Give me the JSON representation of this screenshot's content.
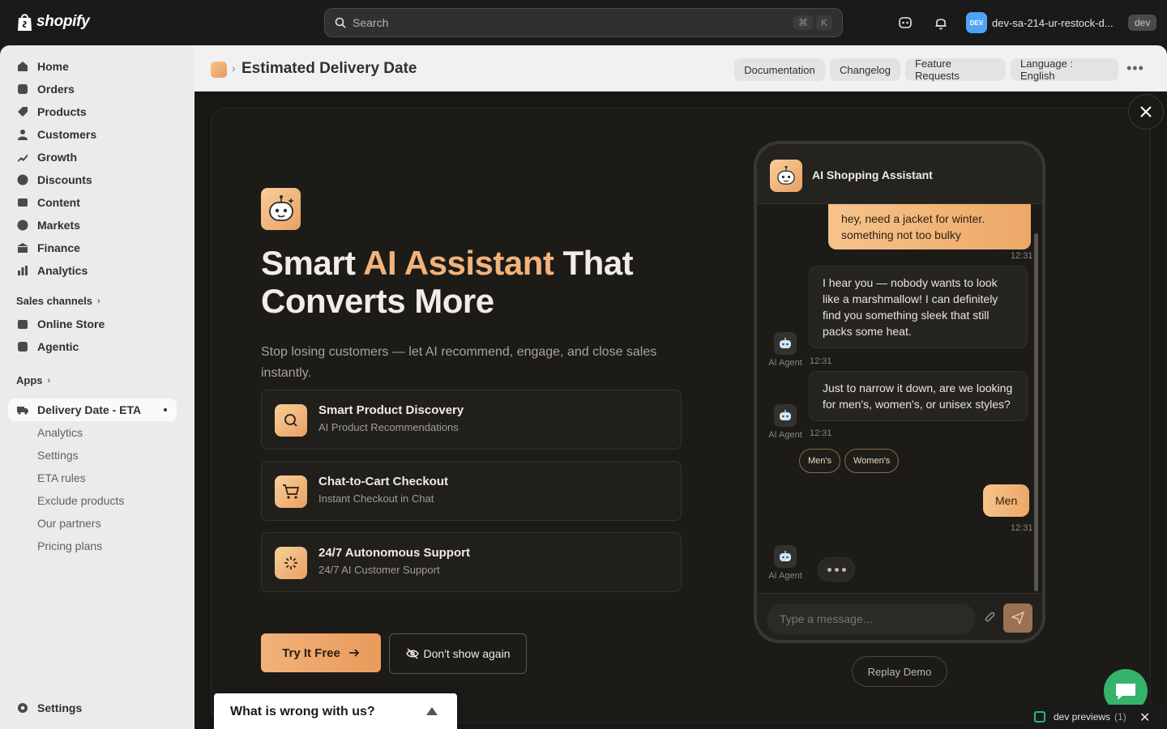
{
  "topbar": {
    "logo_text": "shopify",
    "search_placeholder": "Search",
    "shortcut_cmd": "⌘",
    "shortcut_key": "K",
    "user_initials": "DEV",
    "store_name": "dev-sa-214-ur-restock-d...",
    "env_badge": "dev"
  },
  "sidebar": {
    "items": [
      {
        "label": "Home"
      },
      {
        "label": "Orders"
      },
      {
        "label": "Products"
      },
      {
        "label": "Customers"
      },
      {
        "label": "Growth"
      },
      {
        "label": "Discounts"
      },
      {
        "label": "Content"
      },
      {
        "label": "Markets"
      },
      {
        "label": "Finance"
      },
      {
        "label": "Analytics"
      }
    ],
    "sales_channels_label": "Sales channels",
    "channels": [
      {
        "label": "Online Store"
      },
      {
        "label": "Agentic"
      }
    ],
    "apps_label": "Apps",
    "active_app": "Delivery Date - ETA",
    "sub_items": [
      {
        "label": "Analytics"
      },
      {
        "label": "Settings"
      },
      {
        "label": "ETA rules"
      },
      {
        "label": "Exclude products"
      },
      {
        "label": "Our partners"
      },
      {
        "label": "Pricing plans"
      }
    ],
    "settings_label": "Settings"
  },
  "header": {
    "title": "Estimated Delivery Date",
    "buttons": [
      "Documentation",
      "Changelog",
      "Feature Requests",
      "Language : English"
    ]
  },
  "hero": {
    "title_pre": "Smart ",
    "title_accent": "AI Assistant",
    "title_post": " That Converts More",
    "subtitle": "Stop losing customers — let AI recommend, engage, and close sales instantly.",
    "features": [
      {
        "title": "Smart Product Discovery",
        "subtitle": "AI Product Recommendations"
      },
      {
        "title": "Chat-to-Cart Checkout",
        "subtitle": "Instant Checkout in Chat"
      },
      {
        "title": "24/7 Autonomous Support",
        "subtitle": "24/7 AI Customer Support"
      }
    ],
    "try_label": "Try It Free",
    "dont_show_label": "Don't show again"
  },
  "chat": {
    "title": "AI Shopping Assistant",
    "messages": [
      {
        "from": "user",
        "text": "hey, need a jacket for winter. something not too bulky",
        "time": "12:31"
      },
      {
        "from": "agent",
        "text": "I hear you — nobody wants to look like a marshmallow! I can definitely find you something sleek that still packs some heat.",
        "time": "12:31"
      },
      {
        "from": "agent",
        "text": "Just to narrow it down, are we looking for men's, women's, or unisex styles?",
        "time": "12:31"
      },
      {
        "from": "user",
        "text": "Men",
        "time": "12:31"
      }
    ],
    "agent_label": "AI Agent",
    "quick_replies": [
      "Men's",
      "Women's"
    ],
    "input_placeholder": "Type a message...",
    "replay_label": "Replay Demo"
  },
  "feedback": {
    "title": "What is wrong with us?"
  },
  "dev_previews": {
    "label": "dev previews",
    "count": "(1)"
  }
}
